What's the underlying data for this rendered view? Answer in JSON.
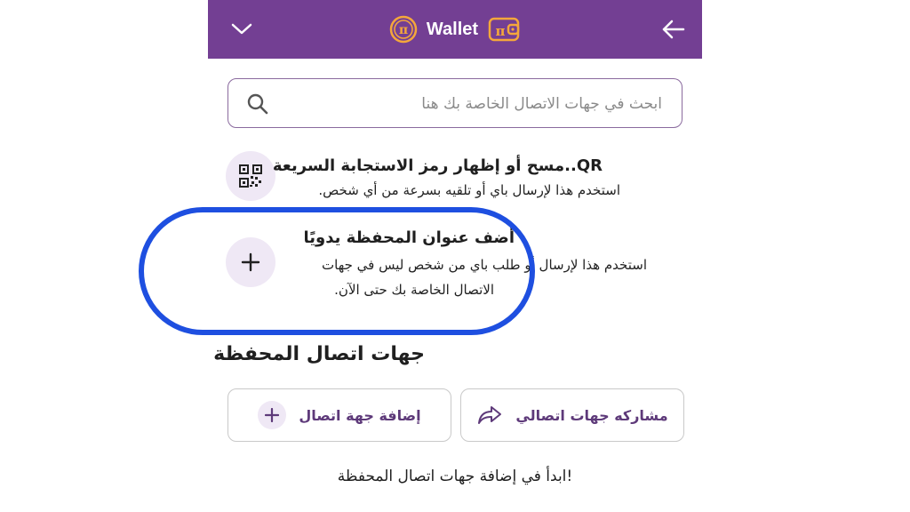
{
  "header": {
    "title": "Wallet",
    "pi_symbol": "π",
    "icons": {
      "left": "chevron-down-icon",
      "right": "arrow-left-icon",
      "logo": "pi-coin-icon",
      "wallet": "wallet-icon"
    },
    "colors": {
      "bar": "#733f93",
      "accent": "#f4a73b"
    }
  },
  "search": {
    "placeholder": "ابحث في جهات الاتصال الخاصة بك هنا",
    "value": ""
  },
  "options": [
    {
      "title": "QR..مسح أو إظهار رمز الاستجابة السريعة",
      "description": "استخدم هذا لإرسال باي أو تلقيه بسرعة من أي شخص.",
      "icon": "qr-code-icon"
    },
    {
      "title": "أضف عنوان المحفظة يدويًا",
      "description_line1": "استخدم هذا لإرسال أو طلب باي من شخص ليس في جهات",
      "description_line2": "الاتصال الخاصة بك حتى الآن.",
      "icon": "plus-icon"
    }
  ],
  "contacts_section": {
    "heading": "جهات اتصال المحفظة",
    "share_button": "مشاركه جهات اتصالي",
    "add_button": "إضافة جهة اتصال",
    "empty_message": "!ابدأ في إضافة جهات اتصال المحفظة"
  },
  "annotation_color": "#1e4fe0"
}
